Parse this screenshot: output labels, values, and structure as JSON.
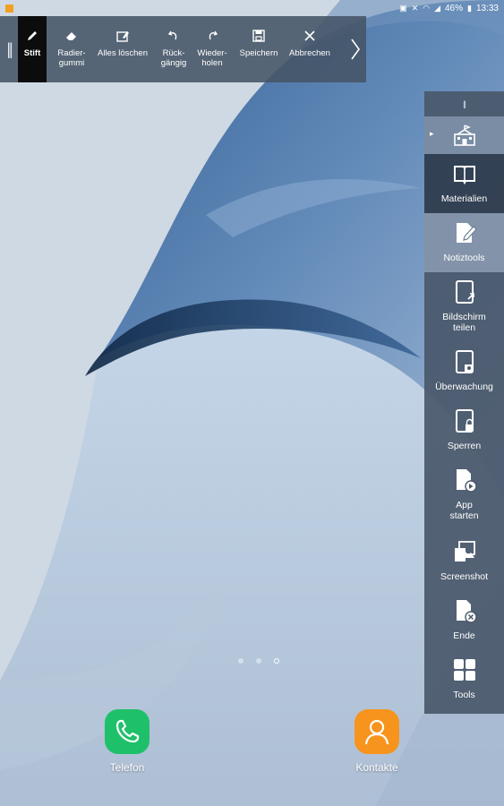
{
  "status_bar": {
    "battery": "46%",
    "time": "13:33"
  },
  "pen_toolbar": {
    "tools": [
      {
        "id": "pen",
        "label": "Stift",
        "icon": "pen-icon",
        "active": true
      },
      {
        "id": "eraser",
        "label": "Radier-\ngummi",
        "icon": "eraser-icon",
        "active": false
      },
      {
        "id": "clear",
        "label": "Alles löschen",
        "icon": "clear-all-icon",
        "active": false
      },
      {
        "id": "undo",
        "label": "Rück-\ngängig",
        "icon": "undo-icon",
        "active": false
      },
      {
        "id": "redo",
        "label": "Wieder-\nholen",
        "icon": "redo-icon",
        "active": false
      },
      {
        "id": "save",
        "label": "Speichern",
        "icon": "save-icon",
        "active": false
      },
      {
        "id": "cancel",
        "label": "Abbrechen",
        "icon": "close-icon",
        "active": false
      }
    ]
  },
  "side_panel": {
    "items": [
      {
        "id": "materialien",
        "label": "Materialien",
        "icon": "book-icon"
      },
      {
        "id": "notiztools",
        "label": "Notiztools",
        "icon": "notes-pen-icon"
      },
      {
        "id": "bildschirm",
        "label": "Bildschirm\nteilen",
        "icon": "share-screen-icon"
      },
      {
        "id": "ueberwachung",
        "label": "Überwachung",
        "icon": "monitor-tablet-icon"
      },
      {
        "id": "sperren",
        "label": "Sperren",
        "icon": "lock-tablet-icon"
      },
      {
        "id": "app_starten",
        "label": "App\nstarten",
        "icon": "launch-app-icon"
      },
      {
        "id": "screenshot",
        "label": "Screenshot",
        "icon": "screenshot-icon"
      },
      {
        "id": "ende",
        "label": "Ende",
        "icon": "end-session-icon"
      },
      {
        "id": "tools",
        "label": "Tools",
        "icon": "grid-tools-icon"
      }
    ],
    "top_icon": "school-icon"
  },
  "home": {
    "page_count": 3,
    "current_page": 3,
    "dock": [
      {
        "label": "Telefon",
        "icon": "phone-icon",
        "color": "#1fc06a"
      },
      {
        "label": "Kontakte",
        "icon": "contacts-icon",
        "color": "#f7941d"
      }
    ]
  }
}
